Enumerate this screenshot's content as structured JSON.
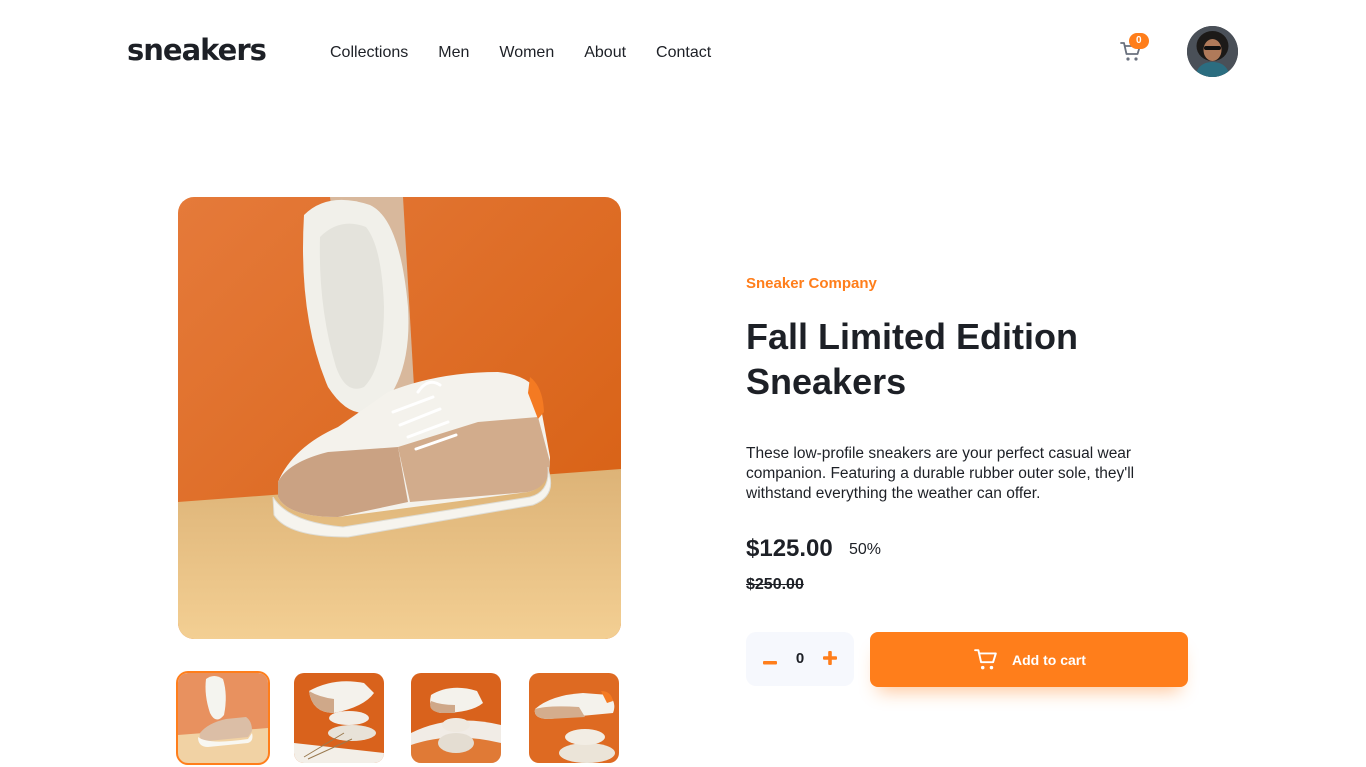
{
  "header": {
    "logo": "sneakers",
    "nav": [
      "Collections",
      "Men",
      "Women",
      "About",
      "Contact"
    ],
    "cart_count": "0",
    "cart_icon": "cart-icon",
    "avatar_icon": "avatar-icon"
  },
  "product": {
    "brand": "Sneaker Company",
    "title": "Fall Limited Edition Sneakers",
    "description": "These low-profile sneakers are your perfect casual wear companion. Featuring a durable rubber outer sole, they'll withstand everything the weather can offer.",
    "price": "$125.00",
    "discount": "50%",
    "original_price": "$250.00",
    "quantity": "0",
    "add_to_cart_label": "Add to cart",
    "minus_icon": "minus-icon",
    "plus_icon": "plus-icon"
  },
  "gallery": {
    "active_thumbnail": 1,
    "thumbnail_count": 4
  },
  "colors": {
    "accent": "#ff7e1b",
    "text_dark": "#1d2026",
    "qty_bg": "#f6f8fd"
  }
}
